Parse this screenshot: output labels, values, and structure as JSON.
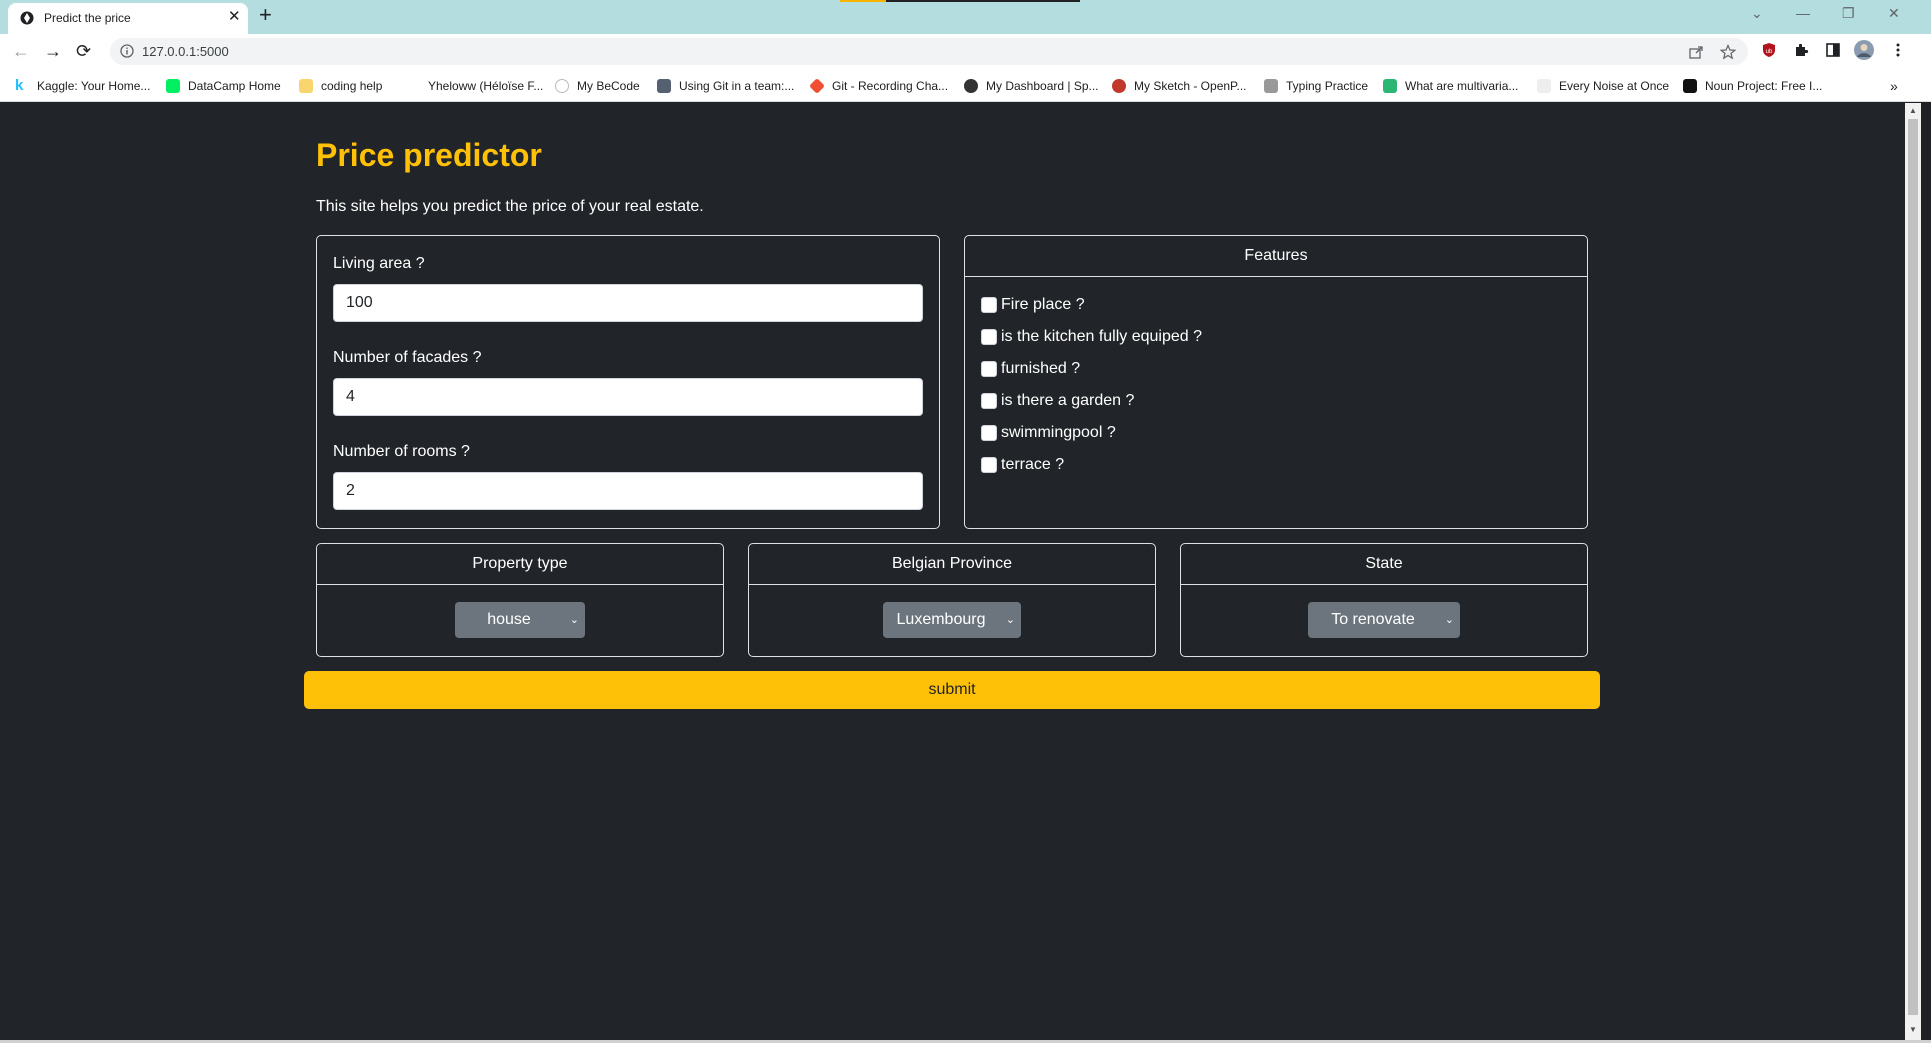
{
  "browser": {
    "tab_title": "Predict the price",
    "tab_close": "✕",
    "new_tab": "+",
    "url": "127.0.0.1:5000",
    "window_controls": {
      "chevron": "⌄",
      "minimize": "—",
      "restore": "❐",
      "close": "✕"
    },
    "nav": {
      "back": "←",
      "forward": "→",
      "reload": "⟳"
    },
    "bookmarks": [
      {
        "label": "Kaggle: Your Home...",
        "icon": "kaggle-icon",
        "color": "#20beff"
      },
      {
        "label": "DataCamp Home",
        "icon": "datacamp-icon",
        "color": "#03ef62"
      },
      {
        "label": "coding help",
        "icon": "folder-icon",
        "color": "#f9d56e"
      },
      {
        "label": "Yheloww (Héloïse F...",
        "icon": "github-icon",
        "color": "#ffffff"
      },
      {
        "label": "My BeCode",
        "icon": "becode-icon",
        "color": "#e0e0e0"
      },
      {
        "label": "Using Git in a team:...",
        "icon": "avatar-icon",
        "color": "#556070"
      },
      {
        "label": "Git - Recording Cha...",
        "icon": "git-icon",
        "color": "#f05032"
      },
      {
        "label": "My Dashboard | Sp...",
        "icon": "dashboard-icon",
        "color": "#333333"
      },
      {
        "label": "My Sketch - OpenP...",
        "icon": "openprocessing-icon",
        "color": "#c0392b"
      },
      {
        "label": "Typing Practice",
        "icon": "typing-icon",
        "color": "#999999"
      },
      {
        "label": "What are multivaria...",
        "icon": "shield-icon",
        "color": "#2bb673"
      },
      {
        "label": "Every Noise at Once",
        "icon": "page-icon",
        "color": "#eeeeee"
      },
      {
        "label": "Noun Project: Free I...",
        "icon": "nounproject-icon",
        "color": "#111111"
      }
    ],
    "bookmarks_more": "»"
  },
  "page": {
    "title": "Price predictor",
    "lead": "This site helps you predict the price of your real estate.",
    "inputs": [
      {
        "label": "Living area ?",
        "value": "100"
      },
      {
        "label": "Number of facades ?",
        "value": "4"
      },
      {
        "label": "Number of rooms ?",
        "value": "2"
      }
    ],
    "features": {
      "header": "Features",
      "items": [
        "Fire place ?",
        "is the kitchen fully equiped ?",
        "furnished ?",
        "is there a garden ?",
        "swimmingpool ?",
        "terrace ?"
      ]
    },
    "selects": [
      {
        "header": "Property type",
        "value": "house"
      },
      {
        "header": "Belgian Province",
        "value": "Luxembourg"
      },
      {
        "header": "State",
        "value": "To renovate"
      }
    ],
    "select_arrow": "⌄",
    "submit_label": "submit"
  },
  "colors": {
    "accent": "#ffc107",
    "page_background": "#212529",
    "select_background": "#6c757d",
    "tabstrip": "#b4dde0"
  }
}
